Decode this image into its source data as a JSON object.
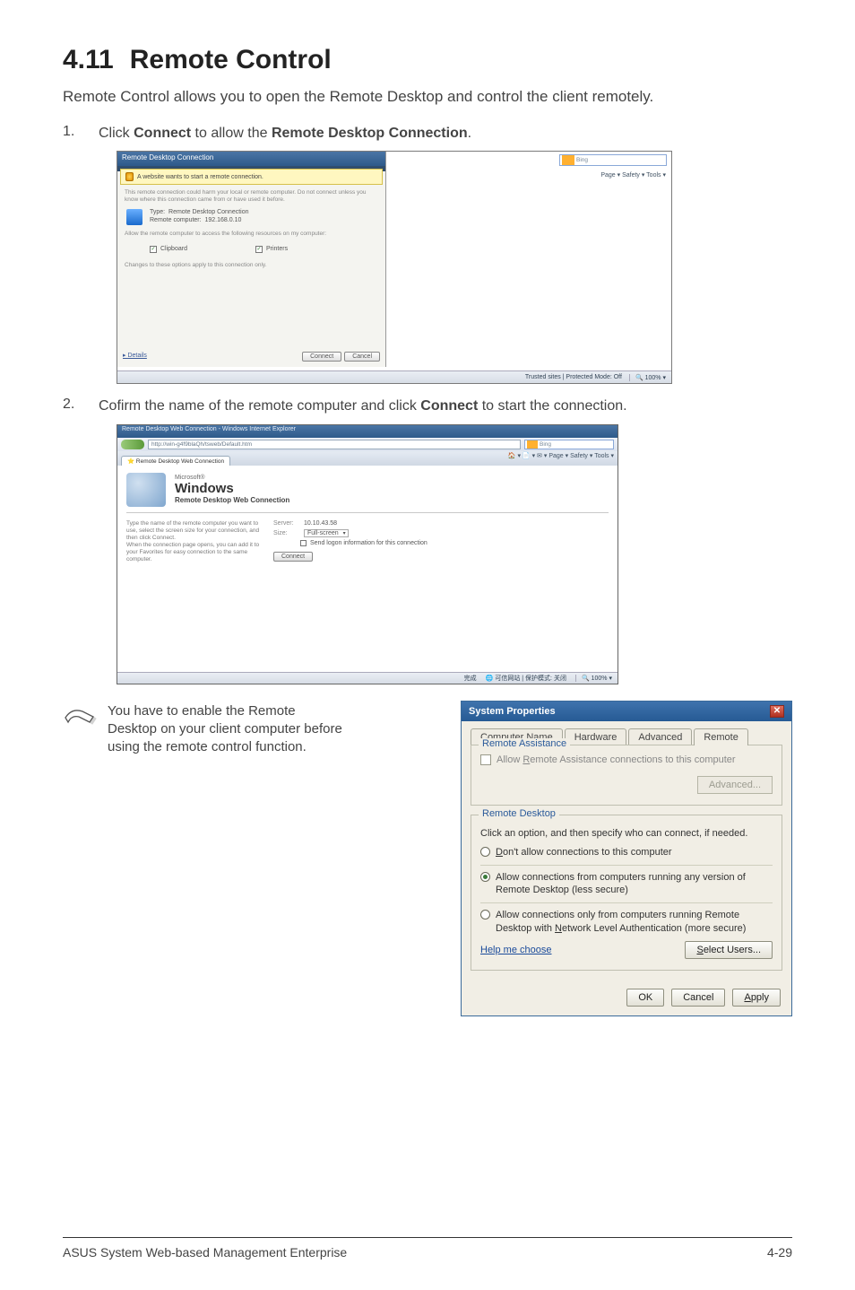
{
  "heading": {
    "number": "4.11",
    "title": "Remote Control"
  },
  "intro": "Remote Control allows you to open the Remote Desktop and control the client remotely.",
  "steps": [
    {
      "num": "1.",
      "prefix": "Click ",
      "bold1": "Connect",
      "mid": " to allow the ",
      "bold2": "Remote Desktop Connection",
      "suffix": "."
    },
    {
      "num": "2.",
      "prefix": "Cofirm the name of the remote computer and click ",
      "bold1": "Connect",
      "mid": " to start the connection.",
      "bold2": "",
      "suffix": ""
    }
  ],
  "shot1": {
    "dlg_title": "Remote Desktop Connection",
    "yellow_bar": "A website wants to start a remote connection.",
    "grey_desc": "This remote connection could harm your local or remote computer. Do not connect unless you know where this connection came from or have used it before.",
    "type_label": "Type:",
    "type_value": "Remote Desktop Connection",
    "remote_label": "Remote computer:",
    "remote_value": "192.168.0.10",
    "allow_prefix": "Allow the remote computer to access the following resources on my computer:",
    "cb1": "Clipboard",
    "cb2": "Printers",
    "changes_note": "Changes to these options apply to this connection only.",
    "details_link": "Details",
    "connect_btn": "Connect",
    "cancel_btn": "Cancel",
    "ie_search_engine": "Bing",
    "ie_tools": "Page ▾   Safety ▾   Tools ▾",
    "status_mode": "Trusted sites | Protected Mode: Off",
    "status_zoom": "100%",
    "titlebtns": "_ ▢ ✕"
  },
  "shot2": {
    "ie_title": "Remote Desktop Web Connection - Windows Internet Explorer",
    "address": "http://win-g4f9blaQh/tsweb/Default.htm",
    "search_engine": "Bing",
    "tab_label": "Remote Desktop Web Connection",
    "toolbar": "🏠 ▾  📄 ▾  ✉ ▾  Page ▾  Safety ▾  Tools ▾",
    "ms": "Microsoft®",
    "windows": "Windows",
    "subtitle": "Remote Desktop Web Connection",
    "left_help": "Type the name of the remote computer you want to use, select the screen size for your connection, and then click Connect.\nWhen the connection page opens, you can add it to your Favorites for easy connection to the same computer.",
    "server_label": "Server:",
    "server_value": "10.10.43.58",
    "size_label": "Size:",
    "size_value": "Full-screen",
    "send_logon": "Send logon information for this connection",
    "connect_btn": "Connect",
    "status_left": "完成",
    "status_mid": "可信网站 | 保护模式: 关闭",
    "status_zoom": "100%"
  },
  "note": {
    "text": "You have to enable the Remote Desktop on your client computer before using the remote control function."
  },
  "sysprop": {
    "title": "System Properties",
    "tabs": [
      "Computer Name",
      "Hardware",
      "Advanced",
      "Remote"
    ],
    "active_tab": 3,
    "ra_legend": "Remote Assistance",
    "ra_checkbox_pre": "Allow ",
    "ra_checkbox_key": "R",
    "ra_checkbox_post": "emote Assistance connections to this computer",
    "advanced_btn": "Advanced...",
    "rd_legend": "Remote Desktop",
    "rd_desc": "Click an option, and then specify who can connect, if needed.",
    "r1_pre": "",
    "r1_key": "D",
    "r1_post": "on't allow connections to this computer",
    "r2_line1": "Allow connections from computers running any version of Remote Desktop (less secure)",
    "r3_line1_pre": "Allow connections only from computers running Remote Desktop with ",
    "r3_key": "N",
    "r3_line1_post": "etwork Level Authentication (more secure)",
    "help_link": "Help me choose",
    "select_users_pre": "",
    "select_users_key": "S",
    "select_users_post": "elect Users...",
    "ok": "OK",
    "cancel": "Cancel",
    "apply_key": "A",
    "apply_post": "pply"
  },
  "footer": {
    "left": "ASUS System Web-based Management Enterprise",
    "right": "4-29"
  }
}
